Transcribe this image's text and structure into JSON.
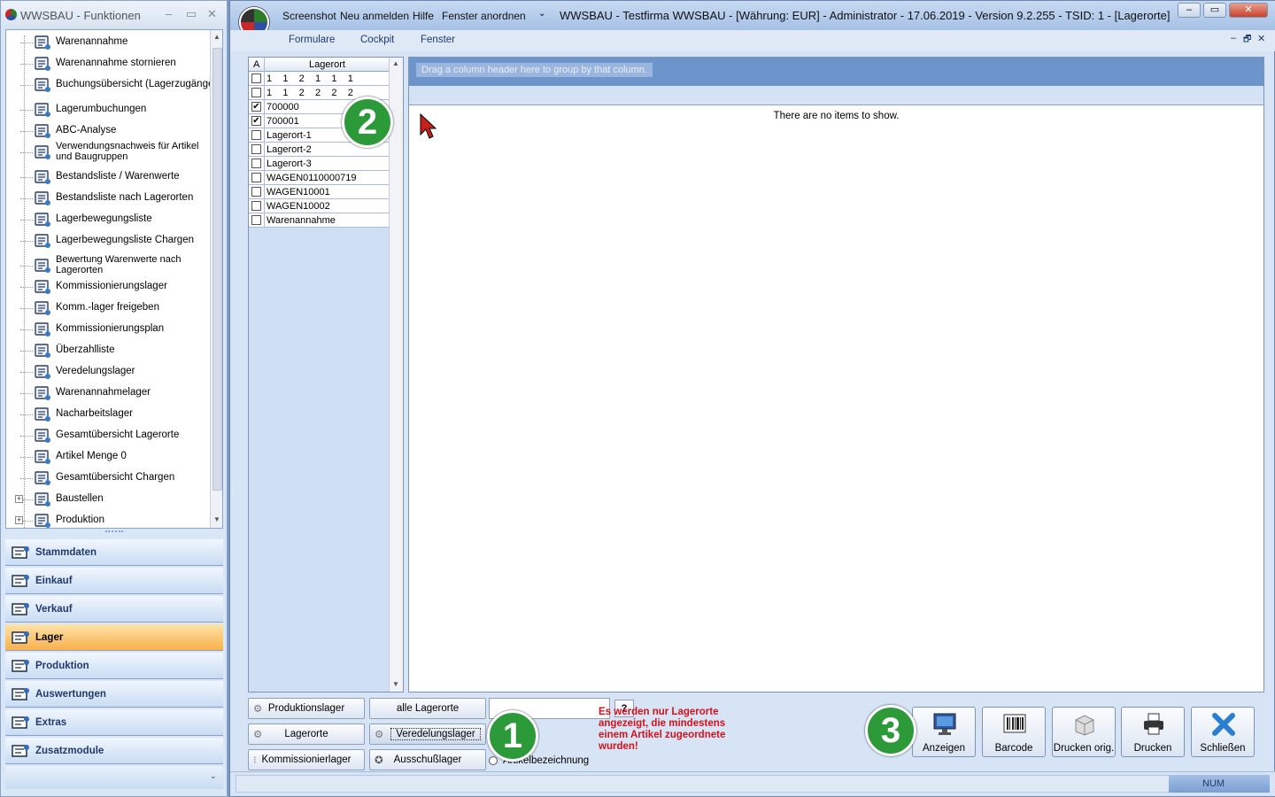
{
  "left_window": {
    "title": "WWSBAU - Funktionen",
    "controls": [
      "–",
      "▭",
      "✕"
    ]
  },
  "tree": [
    {
      "label": "Warenannahme",
      "icon": "inbox-icon"
    },
    {
      "label": "Warenannahme stornieren",
      "icon": "cancel-inbox-icon"
    },
    {
      "label": "Buchungsübersicht (Lagerzugänge)",
      "icon": "ledger-icon"
    },
    {
      "label": "Lagerumbuchungen",
      "icon": "transfer-icon"
    },
    {
      "label": "ABC-Analyse",
      "icon": "abc-check-icon"
    },
    {
      "label": "Verwendungsnachweis für Artikel und Baugruppen",
      "icon": "usage-info-icon"
    },
    {
      "label": "Bestandsliste / Warenwerte",
      "icon": "stock-list-icon"
    },
    {
      "label": "Bestandsliste nach Lagerorten",
      "icon": "warehouse-list-icon"
    },
    {
      "label": "Lagerbewegungsliste",
      "icon": "movement-list-icon"
    },
    {
      "label": "Lagerbewegungsliste Chargen",
      "icon": "batch-movement-icon"
    },
    {
      "label": "Bewertung Warenwerte nach Lagerorten",
      "icon": "valuation-chart-icon"
    },
    {
      "label": "Kommissionierungslager",
      "icon": "picking-store-icon"
    },
    {
      "label": "Komm.-lager freigeben",
      "icon": "release-clock-icon"
    },
    {
      "label": "Kommissionierungsplan",
      "icon": "plan-icon"
    },
    {
      "label": "Überzahlliste",
      "icon": "surplus-icon"
    },
    {
      "label": "Veredelungslager",
      "icon": "refinement-icon"
    },
    {
      "label": "Warenannahmelager",
      "icon": "receiving-store-icon"
    },
    {
      "label": "Nacharbeitslager",
      "icon": "rework-icon"
    },
    {
      "label": "Gesamtübersicht Lagerorte",
      "icon": "map-pin-icon"
    },
    {
      "label": "Artikel Menge 0",
      "icon": "warning-box-icon"
    },
    {
      "label": "Gesamtübersicht Chargen",
      "icon": "monitor-icon"
    },
    {
      "label": "Baustellen",
      "icon": "construction-icon",
      "expander": "+"
    },
    {
      "label": "Produktion",
      "icon": "production-icon",
      "expander": "+"
    }
  ],
  "nav": [
    {
      "label": "Stammdaten",
      "icon": "master-data-icon"
    },
    {
      "label": "Einkauf",
      "icon": "cart-icon"
    },
    {
      "label": "Verkauf",
      "icon": "cash-register-icon"
    },
    {
      "label": "Lager",
      "icon": "warehouse-icon",
      "active": true
    },
    {
      "label": "Produktion",
      "icon": "production-icon"
    },
    {
      "label": "Auswertungen",
      "icon": "analytics-icon"
    },
    {
      "label": "Extras",
      "icon": "extras-icon"
    },
    {
      "label": "Zusatzmodule",
      "icon": "modules-icon"
    }
  ],
  "main": {
    "quick_access": [
      "Screenshot",
      "Neu anmelden",
      "Hilfe",
      "Fenster anordnen"
    ],
    "title": "WWSBAU - Testfirma WWSBAU - [Währung: EUR] - Administrator - 17.06.2019 - Version 9.2.255 - TSID: 1 - [Lagerorte]",
    "menu": [
      "Formulare",
      "Cockpit",
      "Fenster"
    ],
    "mdi_controls": [
      "–",
      "🗗",
      "✕"
    ]
  },
  "list": {
    "col_a": "A",
    "col_name": "Lagerort",
    "rows": [
      {
        "label": "1    1    2    1    1    1",
        "checked": false
      },
      {
        "label": "1    1    2    2    2    2",
        "checked": false
      },
      {
        "label": "700000",
        "checked": true
      },
      {
        "label": "700001",
        "checked": true
      },
      {
        "label": "Lagerort-1",
        "checked": false
      },
      {
        "label": "Lagerort-2",
        "checked": false
      },
      {
        "label": "Lagerort-3",
        "checked": false
      },
      {
        "label": "WAGEN0110000719",
        "checked": false
      },
      {
        "label": "WAGEN10001",
        "checked": false
      },
      {
        "label": "WAGEN10002",
        "checked": false
      },
      {
        "label": "Warenannahme",
        "checked": false
      }
    ]
  },
  "grid": {
    "group_hint": "Drag a column header here to group by that column.",
    "empty": "There are no items to show."
  },
  "filters": {
    "col1": [
      "Produktionslager",
      "Lagerorte",
      "Kommissionierlager"
    ],
    "col2": [
      "alle Lagerorte",
      "Veredelungslager",
      "Ausschußlager"
    ],
    "search_btn": "?",
    "warning": "Es werden nur Lagerorte angezeigt, die mindestens einem Artikel zugeordnete wurden!",
    "radio_label": "Artikelbezeichnung"
  },
  "toolbar": [
    {
      "label": "Anzeigen",
      "icon": "monitor-icon"
    },
    {
      "label": "Barcode",
      "icon": "barcode-icon"
    },
    {
      "label": "Drucken orig.",
      "icon": "box-print-icon"
    },
    {
      "label": "Drucken",
      "icon": "printer-icon"
    },
    {
      "label": "Schließen",
      "icon": "close-x-icon"
    }
  ],
  "status": {
    "num": "NUM"
  },
  "badges": [
    "2",
    "1",
    "3"
  ],
  "colors": {
    "accent": "#6e94cc",
    "active_nav": "#f9b14c",
    "warning": "#d8101a",
    "badge": "#2d9a3a"
  }
}
